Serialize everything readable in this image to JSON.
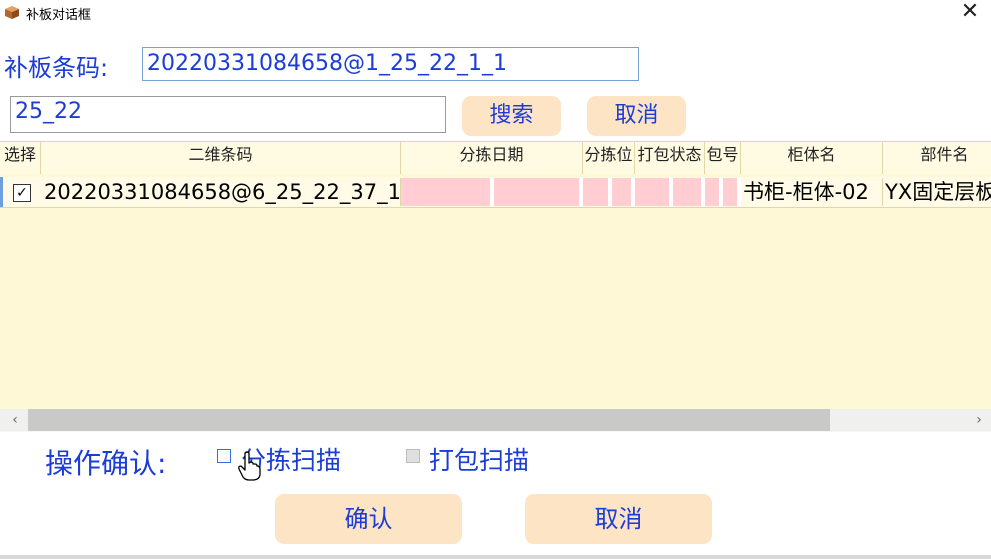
{
  "window": {
    "title": "补板对话框",
    "close_symbol": "✕"
  },
  "form": {
    "barcode_label": "补板条码:",
    "barcode_value": "20220331084658@1_25_22_1_1",
    "search_value": "25_22",
    "search_button": "搜索",
    "cancel_button": "取消"
  },
  "grid": {
    "columns": [
      "选择",
      "二维条码",
      "分拣日期",
      "分拣位",
      "打包状态",
      "包号",
      "柜体名",
      "部件名"
    ],
    "rows": [
      {
        "selected": true,
        "check_symbol": "✓",
        "barcode": "20220331084658@6_25_22_37_1",
        "sort_date": "",
        "sort_position": "",
        "pack_status": "",
        "package_no": "",
        "cabinet_name": "书柜-柜体-02",
        "part_name": "YX固定层板"
      }
    ],
    "scroll_left": "‹",
    "scroll_right": "›"
  },
  "operation": {
    "label": "操作确认:",
    "sort_scan_label": "分拣扫描",
    "sort_scan_checked": false,
    "pack_scan_label": "打包扫描",
    "pack_scan_checked": false,
    "pack_scan_disabled": true
  },
  "footer": {
    "confirm_button": "确认",
    "cancel_button": "取消"
  },
  "colors": {
    "accent_text": "#1b3dd6",
    "button_bg": "#fde4c4",
    "grid_bg": "#fff8d6",
    "highlight_cell": "#ffcdd2"
  }
}
